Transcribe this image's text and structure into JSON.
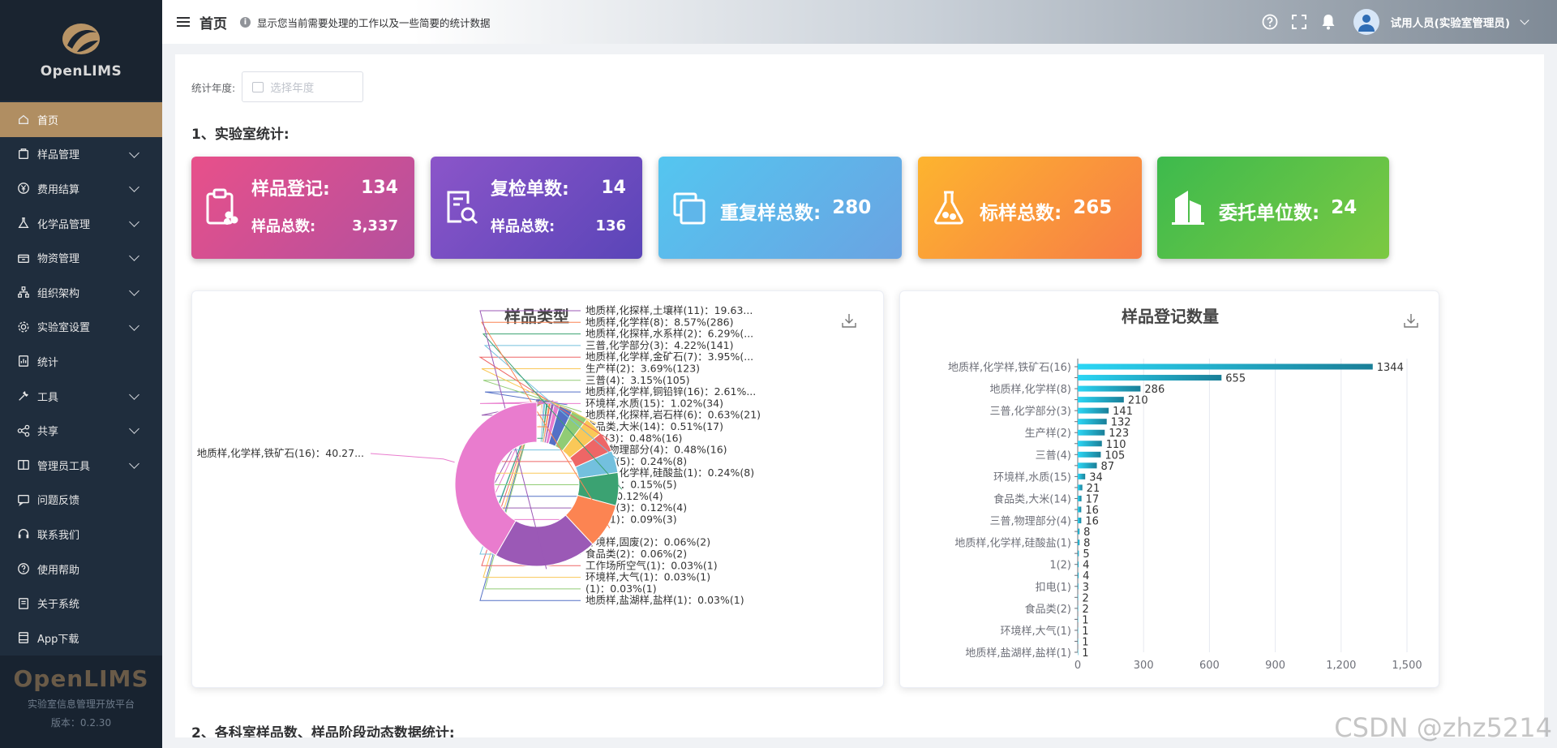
{
  "sidebar": {
    "brand": "OpenLIMS",
    "items": [
      {
        "label": "首页",
        "icon": "home-icon",
        "expandable": false,
        "active": true
      },
      {
        "label": "样品管理",
        "icon": "sample-icon",
        "expandable": true
      },
      {
        "label": "费用结算",
        "icon": "yen-icon",
        "expandable": true
      },
      {
        "label": "化学品管理",
        "icon": "flask-icon",
        "expandable": true
      },
      {
        "label": "物资管理",
        "icon": "box-icon",
        "expandable": true
      },
      {
        "label": "组织架构",
        "icon": "org-icon",
        "expandable": true
      },
      {
        "label": "实验室设置",
        "icon": "gear-icon",
        "expandable": true
      },
      {
        "label": "统计",
        "icon": "stats-icon",
        "expandable": false
      },
      {
        "label": "工具",
        "icon": "tools-icon",
        "expandable": true
      },
      {
        "label": "共享",
        "icon": "share-icon",
        "expandable": true
      },
      {
        "label": "管理员工具",
        "icon": "admin-icon",
        "expandable": true
      },
      {
        "label": "问题反馈",
        "icon": "feedback-icon",
        "expandable": false
      },
      {
        "label": "联系我们",
        "icon": "headset-icon",
        "expandable": false
      },
      {
        "label": "使用帮助",
        "icon": "help-icon",
        "expandable": false
      },
      {
        "label": "关于系统",
        "icon": "book-icon",
        "expandable": false
      },
      {
        "label": "App下载",
        "icon": "app-icon",
        "expandable": false
      }
    ],
    "footer": {
      "brand": "OpenLIMS",
      "subtitle": "实验室信息管理开放平台",
      "version": "版本：0.2.30"
    }
  },
  "header": {
    "title": "首页",
    "description": "显示您当前需要处理的工作以及一些简要的统计数据",
    "user": "试用人员(实验室管理员)"
  },
  "filters": {
    "year_label": "统计年度:",
    "year_placeholder": "选择年度"
  },
  "sections": {
    "lab_stats": "1、实验室统计:",
    "dynamic": "2、各科室样品数、样品阶段动态数据统计:"
  },
  "cards": {
    "c1": {
      "label1": "样品登记:",
      "value1": "134",
      "label2": "样品总数:",
      "value2": "3,337"
    },
    "c2": {
      "label1": "复检单数:",
      "value1": "14",
      "label2": "样品总数:",
      "value2": "136"
    },
    "c3": {
      "label": "重复样总数:",
      "value": "280"
    },
    "c4": {
      "label": "标样总数:",
      "value": "265"
    },
    "c5": {
      "label": "委托单位数:",
      "value": "24"
    }
  },
  "colors": {
    "card1": "#e8508a",
    "card2": "#8b55c9",
    "card3": "#54c6f0",
    "card4": "#fdb42f",
    "card5": "#3dba4d",
    "sidebar_active": "#b08e62"
  },
  "chart_data": [
    {
      "type": "pie",
      "title": "样品类型",
      "slices": [
        {
          "label": "地质样,化学样,铁矿石(16)：40.27...",
          "value": 40.27,
          "color": "#e97cce"
        },
        {
          "label": "地质样,化探样,土壤样(11)：19.63...",
          "value": 19.63,
          "color": "#9b59b6"
        },
        {
          "label": "地质样,化学样(8)：8.57%(286)",
          "value": 8.57,
          "color": "#fc8452"
        },
        {
          "label": "地质样,化探样,水系样(2)：6.29%(...",
          "value": 6.29,
          "color": "#3ba272"
        },
        {
          "label": "三普,化学部分(3)：4.22%(141)",
          "value": 4.22,
          "color": "#73c0de"
        },
        {
          "label": "地质样,化学样,金矿石(7)：3.95%(...",
          "value": 3.95,
          "color": "#ee6666"
        },
        {
          "label": "生产样(2)：3.69%(123)",
          "value": 3.69,
          "color": "#fac858"
        },
        {
          "label": "三普(4)：3.15%(105)",
          "value": 3.15,
          "color": "#91cc75"
        },
        {
          "label": "地质样,化学样,铜铅锌(16)：2.61%...",
          "value": 2.61,
          "color": "#5470c6"
        },
        {
          "label": "环境样,水质(15)：1.02%(34)",
          "value": 1.02,
          "color": "#e97cce"
        },
        {
          "label": "地质样,化探样,岩石样(6)：0.63%(21)",
          "value": 0.63,
          "color": "#9a60b4"
        },
        {
          "label": "食品类,大米(14)：0.51%(17)",
          "value": 0.51,
          "color": "#fc8452"
        },
        {
          "label": "123(3)：0.48%(16)",
          "value": 0.48,
          "color": "#3ba272"
        },
        {
          "label": "三普,物理部分(4)：0.48%(16)",
          "value": 0.48,
          "color": "#73c0de"
        },
        {
          "label": "地质样(5)：0.24%(8)",
          "value": 0.24,
          "color": "#ee6666"
        },
        {
          "label": "地质样,化学样,硅酸盐(1)：0.24%(8)",
          "value": 0.24,
          "color": "#fac858"
        },
        {
          "label": "水质(1)：0.15%(5)",
          "value": 0.15,
          "color": "#91cc75"
        },
        {
          "label": "1(2)：0.12%(4)",
          "value": 0.12,
          "color": "#5470c6"
        },
        {
          "label": "环境样(3)：0.12%(4)",
          "value": 0.12,
          "color": "#9a60b4"
        },
        {
          "label": "扣电(1)：0.09%(3)",
          "value": 0.09,
          "color": "#ea7ccc"
        },
        {
          "label": "环境样,固废(2)：0.06%(2)",
          "value": 0.06,
          "color": "#3ba272"
        },
        {
          "label": "食品类(2)：0.06%(2)",
          "value": 0.06,
          "color": "#73c0de"
        },
        {
          "label": "工作场所空气(1)：0.03%(1)",
          "value": 0.03,
          "color": "#ee6666"
        },
        {
          "label": "环境样,大气(1)：0.03%(1)",
          "value": 0.03,
          "color": "#fac858"
        },
        {
          "label": "(1)：0.03%(1)",
          "value": 0.03,
          "color": "#91cc75"
        },
        {
          "label": "地质样,盐湖样,盐样(1)：0.03%(1)",
          "value": 0.03,
          "color": "#5470c6"
        }
      ]
    },
    {
      "type": "bar",
      "orientation": "horizontal",
      "title": "样品登记数量",
      "categories": [
        "地质样,化学样,铁矿石(16)",
        "",
        "地质样,化学样(8)",
        "",
        "三普,化学部分(3)",
        "",
        "生产样(2)",
        "",
        "三普(4)",
        "",
        "环境样,水质(15)",
        "",
        "食品类,大米(14)",
        "",
        "三普,物理部分(4)",
        "",
        "地质样,化学样,硅酸盐(1)",
        "",
        "1(2)",
        "",
        "扣电(1)",
        "",
        "食品类(2)",
        "",
        "环境样,大气(1)",
        "",
        "地质样,盐湖样,盐样(1)"
      ],
      "values": [
        1344,
        655,
        286,
        210,
        141,
        132,
        123,
        110,
        105,
        87,
        34,
        21,
        17,
        16,
        16,
        8,
        8,
        5,
        4,
        4,
        3,
        2,
        2,
        1,
        1,
        1,
        1
      ],
      "xlim": [
        0,
        1500
      ],
      "xticks": [
        "0",
        "300",
        "600",
        "900",
        "1,200",
        "1,500"
      ],
      "grid": true
    }
  ],
  "watermark": "CSDN @zhz5214"
}
